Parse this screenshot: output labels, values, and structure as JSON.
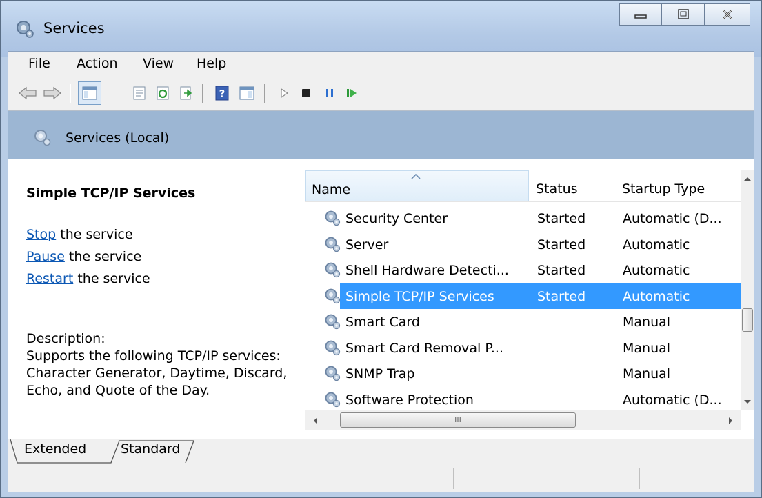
{
  "window": {
    "title": "Services",
    "title_icon": "gear-icon"
  },
  "window_controls": {
    "minimize": "minimize-icon",
    "maximize": "maximize-icon",
    "close": "close-icon"
  },
  "menu": [
    "File",
    "Action",
    "View",
    "Help"
  ],
  "toolbar": [
    "back-icon",
    "forward-icon",
    "console-tree-icon",
    "properties-icon",
    "refresh-icon",
    "export-list-icon",
    "help-icon",
    "show-hide-action-pane-icon",
    "start-service-icon",
    "stop-service-icon",
    "pause-service-icon",
    "resume-service-icon"
  ],
  "header": {
    "title": "Services (Local)"
  },
  "details": {
    "service_name": "Simple TCP/IP Services",
    "actions": [
      {
        "link": "Stop",
        "rest": " the service"
      },
      {
        "link": "Pause",
        "rest": " the service"
      },
      {
        "link": "Restart",
        "rest": " the service"
      }
    ],
    "description_label": "Description:",
    "description": "Supports the following TCP/IP services: Character Generator, Daytime, Discard, Echo, and Quote of the Day."
  },
  "list": {
    "columns": [
      "Name",
      "Status",
      "Startup Type"
    ],
    "rows": [
      {
        "name": "Security Center",
        "status": "Started",
        "startup": "Automatic (D..."
      },
      {
        "name": "Server",
        "status": "Started",
        "startup": "Automatic"
      },
      {
        "name": "Shell Hardware Detecti...",
        "status": "Started",
        "startup": "Automatic"
      },
      {
        "name": "Simple TCP/IP Services",
        "status": "Started",
        "startup": "Automatic"
      },
      {
        "name": "Smart Card",
        "status": "",
        "startup": "Manual"
      },
      {
        "name": "Smart Card Removal P...",
        "status": "",
        "startup": "Manual"
      },
      {
        "name": "SNMP Trap",
        "status": "",
        "startup": "Manual"
      },
      {
        "name": "Software Protection",
        "status": "",
        "startup": "Automatic (D..."
      }
    ],
    "selected_index": 3
  },
  "hscroll_grip": "III",
  "tabs": [
    "Extended",
    "Standard"
  ],
  "colors": {
    "selection": "#3399ff",
    "header_band": "#9cb6d3",
    "link": "#0b57b4"
  }
}
